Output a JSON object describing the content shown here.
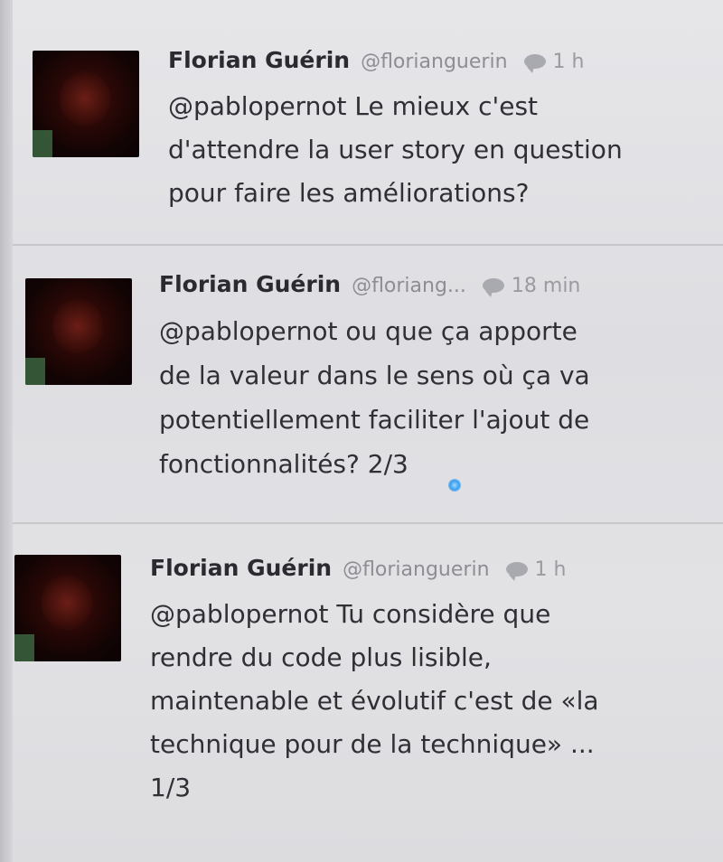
{
  "tweets": [
    {
      "name": "Florian Guérin",
      "handle": "@florianguerin",
      "time": "1 h",
      "text": "@pablopernot Le mieux c'est\nd'attendre la user story en question\npour faire les améliorations?"
    },
    {
      "name": "Florian Guérin",
      "handle": "@floriang...",
      "time": "18 min",
      "text": "@pablopernot ou que ça apporte\nde la valeur dans le sens où ça va\npotentiellement faciliter l'ajout de\nfonctionnalités?  2/3"
    },
    {
      "name": "Florian Guérin",
      "handle": "@florianguerin",
      "time": "1 h",
      "text": "@pablopernot Tu considère que\nrendre du code plus lisible,\nmaintenable et évolutif c'est de «la\ntechnique pour de la technique» ...\n1/3"
    }
  ],
  "icons": {
    "reply": "reply-bubble-icon",
    "cursor": "pointer-dot-icon"
  },
  "colors": {
    "background": "#e2e2e5",
    "name": "#2a2a30",
    "meta": "#8d8d94",
    "cursor": "#3aa0f0"
  }
}
